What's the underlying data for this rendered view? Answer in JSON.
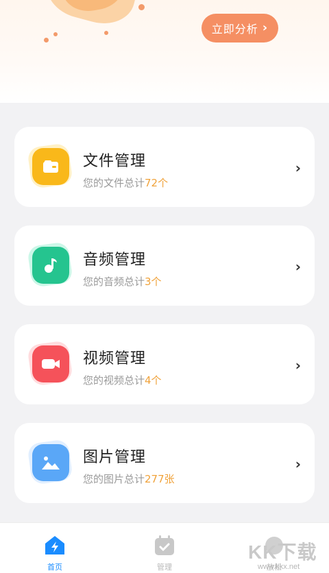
{
  "hero": {
    "analyze_label": "立即分析"
  },
  "cards": [
    {
      "title": "文件管理",
      "prefix": "您的文件总计",
      "count": "72个",
      "icon": "folder-icon",
      "color": "#f9b81a",
      "glow": "#ffd65c"
    },
    {
      "title": "音频管理",
      "prefix": "您的音频总计",
      "count": "3个",
      "icon": "music-note-icon",
      "color": "#25c48f",
      "glow": "#6ce7bd"
    },
    {
      "title": "视频管理",
      "prefix": "您的视频总计",
      "count": "4个",
      "icon": "video-camera-icon",
      "color": "#f5525a",
      "glow": "#ff9aa0"
    },
    {
      "title": "图片管理",
      "prefix": "您的图片总计",
      "count": "277张",
      "icon": "image-icon",
      "color": "#5aa7f7",
      "glow": "#a8d2ff"
    }
  ],
  "tabs": [
    {
      "label": "首页",
      "icon": "home-lightning-icon",
      "active": true
    },
    {
      "label": "管理",
      "icon": "calendar-check-icon",
      "active": false
    },
    {
      "label": "放松",
      "icon": "relax-icon",
      "active": false
    }
  ],
  "watermark": {
    "text": "KK下载",
    "url": "www.kkx.net"
  },
  "colors": {
    "accent": "#f58f63",
    "count": "#f0a23a",
    "tab_active": "#1a8cff",
    "tab_inactive": "#b8b8b8"
  }
}
